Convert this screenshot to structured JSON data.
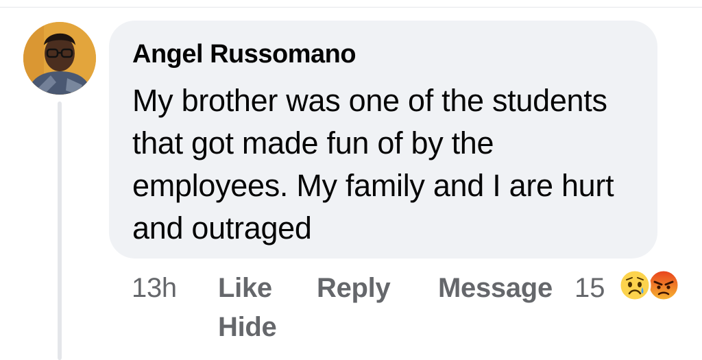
{
  "comment": {
    "author": "Angel Russomano",
    "text": "My brother was one of the students that got made fun of by the employees. My family and I are hurt and outraged",
    "timestamp": "13h",
    "actions": {
      "like": "Like",
      "reply": "Reply",
      "message": "Message",
      "hide": "Hide"
    },
    "reactions": {
      "count": "15",
      "types": [
        "sad-emoji",
        "angry-emoji"
      ]
    }
  },
  "colors": {
    "bubble": "#f0f2f5",
    "action_text": "#65676b",
    "text": "#050505"
  }
}
